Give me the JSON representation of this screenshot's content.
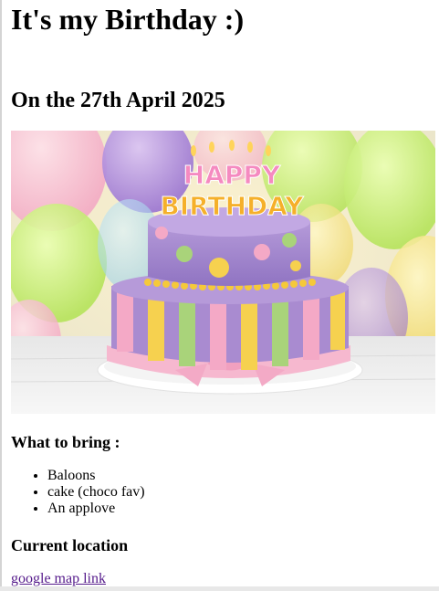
{
  "page": {
    "title": "It's my Birthday :)",
    "date_heading": "On the 27th April 2025"
  },
  "image": {
    "description": "birthday-cake-photo",
    "topper_line1": "HAPPY",
    "topper_line2": "BIRTHDAY"
  },
  "bring": {
    "heading": "What to bring :",
    "items": [
      "Baloons",
      "cake (choco fav)",
      "An applove"
    ]
  },
  "location": {
    "heading": "Current location",
    "link_text": "google map link"
  },
  "colors": {
    "link_visited": "#551a8b",
    "cake_purple": "#a98bd0",
    "cake_pink": "#f4a9c6",
    "cake_yellow": "#f6d14f",
    "cake_green": "#a9d37a"
  }
}
